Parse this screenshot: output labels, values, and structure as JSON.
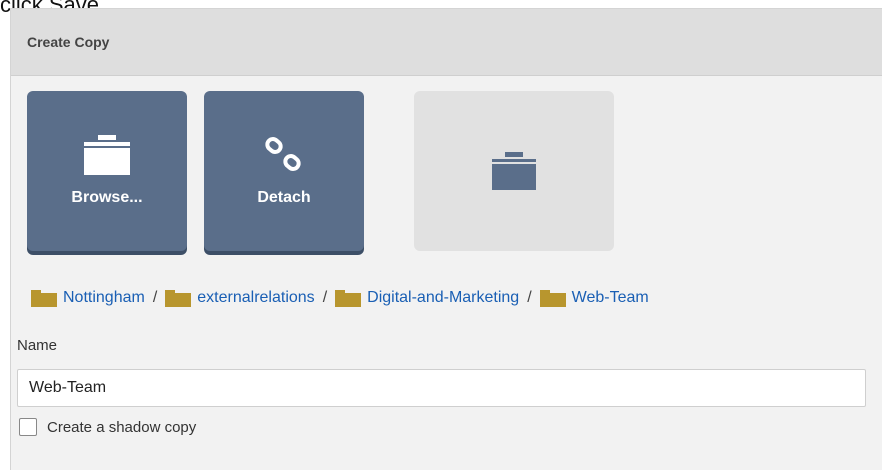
{
  "instruction": "click Save",
  "dialog": {
    "title": "Create Copy",
    "tiles": [
      {
        "label": "Browse...",
        "icon": "folder-icon"
      },
      {
        "label": "Detach",
        "icon": "chain-link-icon"
      },
      {
        "label": "",
        "icon": "folder-icon"
      }
    ],
    "breadcrumb": [
      "Nottingham",
      "externalrelations",
      "Digital-and-Marketing",
      "Web-Team"
    ],
    "breadcrumb_separator": "/",
    "name_label": "Name",
    "name_value": "Web-Team",
    "shadow_copy_label": "Create a shadow copy",
    "shadow_copy_checked": false
  },
  "colors": {
    "tile": "#5a6e8a",
    "tile_empty": "#e1e1e1",
    "link": "#1a5fb4",
    "folder": "#b8962e"
  }
}
